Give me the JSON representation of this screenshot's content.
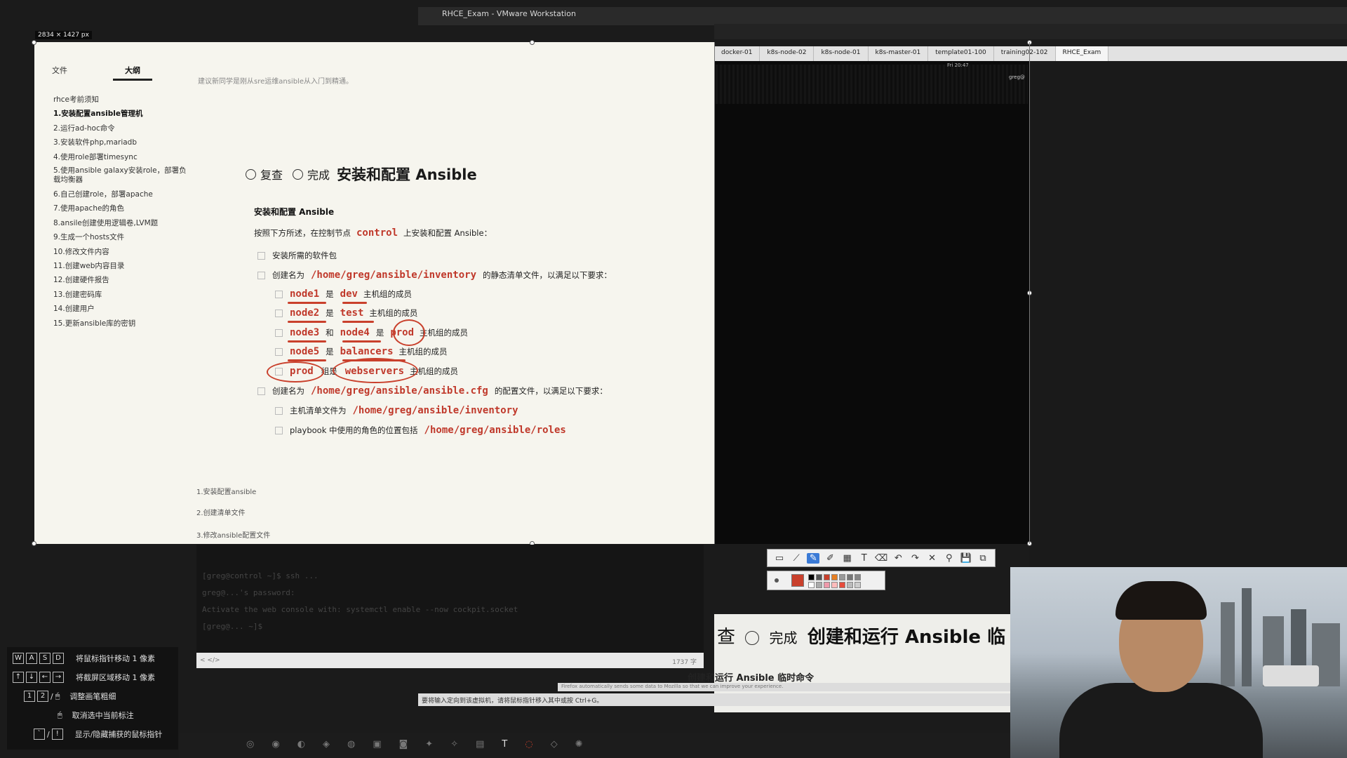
{
  "vmware": {
    "title": "RHCE_Exam - VMware Workstation",
    "tabs": [
      "docker-01",
      "k8s-node-02",
      "k8s-node-01",
      "k8s-master-01",
      "template01-100",
      "training02-102",
      "RHCE_Exam"
    ],
    "clock": "Fri 20:47",
    "user": "greg@"
  },
  "capture": {
    "dimensions": "2834 × 1427 px"
  },
  "sidebar": {
    "tabs": [
      "文件",
      "大纲"
    ],
    "active_tab": "大纲",
    "items": [
      "rhce考前须知",
      "1.安装配置ansible管理机",
      "2.运行ad-hoc命令",
      "3.安装软件php,mariadb",
      "4.使用role部署timesync",
      "5.使用ansible galaxy安装role，部署负载均衡器",
      "6.自己创建role，部署apache",
      "7.使用apache的角色",
      "8.ansile创建使用逻辑卷,LVM题",
      "9.生成一个hosts文件",
      "10.修改文件内容",
      "11.创建web内容目录",
      "12.创建硬件报告",
      "13.创建密码库",
      "14.创建用户",
      "15.更新ansible库的密钥"
    ]
  },
  "doc": {
    "intro": "建议新同学是刚从sre运维ansible从入门到精通。",
    "radio_review": "复查",
    "radio_done": "完成",
    "title": "安装和配置 Ansible",
    "section_title": "安装和配置 Ansible",
    "instruction_pre": "按照下方所述，在控制节点",
    "control": "control",
    "instruction_post": "上安装和配置 Ansible：",
    "task1": "安装所需的软件包",
    "task2_pre": "创建名为",
    "inventory_path": "/home/greg/ansible/inventory",
    "task2_post": "的静态清单文件，以满足以下要求：",
    "n1": "node1",
    "shi": "是",
    "dev": "dev",
    "member": "主机组的成员",
    "n2": "node2",
    "test": "test",
    "n3": "node3",
    "he": "和",
    "n4": "node4",
    "prod": "prod",
    "n5": "node5",
    "balancers": "balancers",
    "prod2": "prod",
    "zu": "组是",
    "webservers": "webservers",
    "task3_pre": "创建名为",
    "cfg_path": "/home/greg/ansible/ansible.cfg",
    "task3_post": "的配置文件，以满足以下要求：",
    "sub1_pre": "主机清单文件为",
    "sub1_path": "/home/greg/ansible/inventory",
    "sub2_pre": "playbook 中使用的角色的位置包括",
    "sub2_path": "/home/greg/ansible/roles",
    "steps": [
      "1.安装配置ansible",
      "2.创建清单文件",
      "3.修改ansible配置文件"
    ]
  },
  "terminal": {
    "lines": [
      "[greg@control ~]$ ssh ...",
      "greg@...'s password:",
      "Activate the web console with: systemctl enable --now cockpit.socket",
      "[greg@... ~]$"
    ],
    "footer_left": "< </>",
    "footer_right": "1737 字"
  },
  "slide": {
    "heading_prefix": "查",
    "heading_done": "完成",
    "heading_title": "创建和运行 Ansible 临",
    "subheading": "创建和运行 Ansible 临时命令",
    "note": "Firefox automatically sends some data to Mozilla so that we can improve your experience."
  },
  "status_bar": "要将输入定向到该虚拟机，请将鼠标指针移入其中或按 Ctrl+G。",
  "help": [
    {
      "keys": [
        "W",
        "A",
        "S",
        "D"
      ],
      "label": "将鼠标指针移动 1 像素"
    },
    {
      "keys": [
        "↑",
        "↓",
        "←",
        "→"
      ],
      "label": "将截屏区域移动 1 像素"
    },
    {
      "keys": [
        "1",
        "2",
        "/",
        "🖱"
      ],
      "label": "调整画笔粗细"
    },
    {
      "keys": [
        "🖱"
      ],
      "label": "取消选中当前标注"
    },
    {
      "keys": [
        "`",
        "/",
        "!"
      ],
      "label": "显示/隐藏捕获的鼠标指针"
    }
  ],
  "colors": {
    "annotation": "#c9402c",
    "path_text": "#c0392b",
    "doc_bg": "#f6f5ee"
  }
}
